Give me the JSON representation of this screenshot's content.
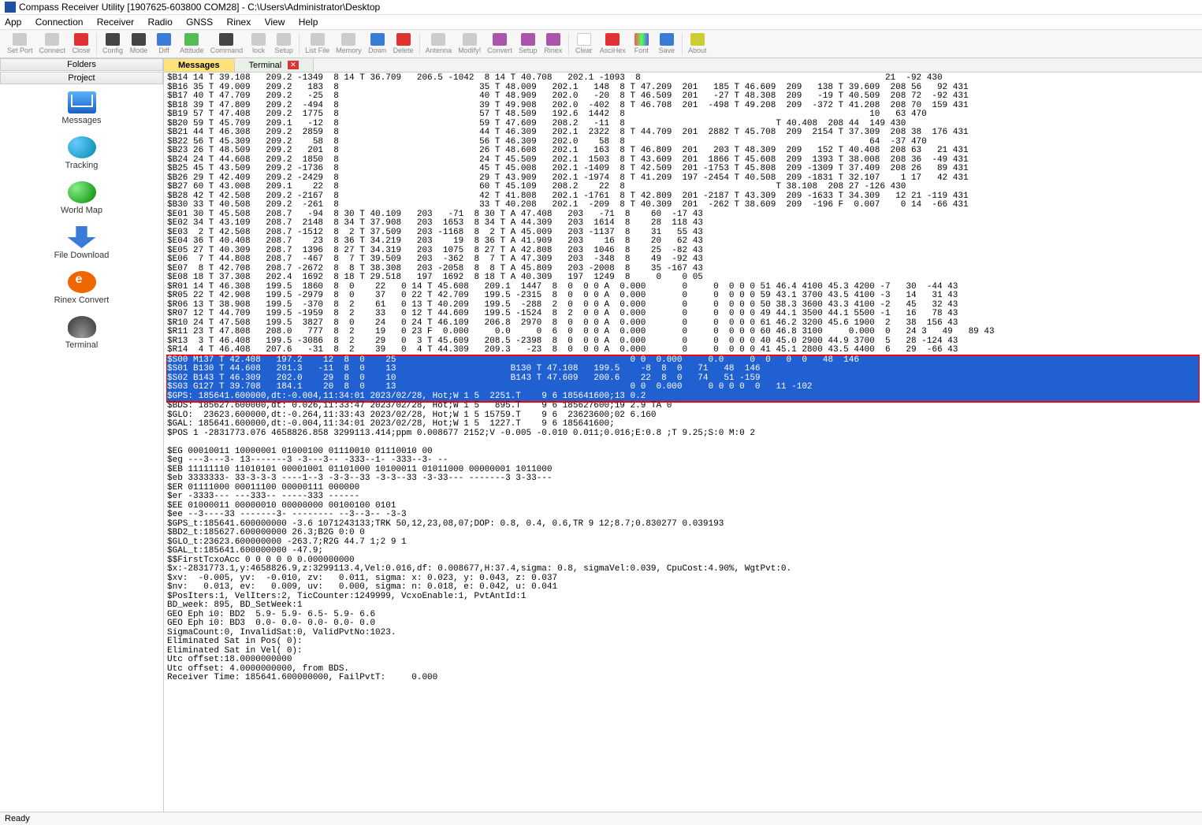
{
  "window": {
    "title": "Compass Receiver Utility [1907625-603800 COM28] - C:\\Users\\Administrator\\Desktop"
  },
  "menu": {
    "items": [
      "App",
      "Connection",
      "Receiver",
      "Radio",
      "GNSS",
      "Rinex",
      "View",
      "Help"
    ]
  },
  "toolbar": {
    "buttons": [
      "Set Port",
      "Connect",
      "Close",
      "Config",
      "Mode",
      "Diff",
      "Attitude",
      "Command",
      "lock",
      "Setup",
      "List File",
      "Memory",
      "Down",
      "Delete",
      "Antenna",
      "Modify!",
      "Convert",
      "Setup",
      "Rinex",
      "Clear",
      "AsciHex",
      "Font",
      "Save",
      "About"
    ]
  },
  "sidebar": {
    "folders": "Folders",
    "project": "Project",
    "items": [
      {
        "label": "Messages"
      },
      {
        "label": "Tracking"
      },
      {
        "label": "World Map"
      },
      {
        "label": "File Download"
      },
      {
        "label": "Rinex Convert"
      },
      {
        "label": "Terminal"
      }
    ]
  },
  "tabs": {
    "messages": "Messages",
    "terminal": "Terminal"
  },
  "terminal": {
    "pre": "$B14 14 T 39.108   209.2 -1349  8 14 T 36.709   206.5 -1042  8 14 T 40.708   202.1 -1093  8                                               21  -92 430\n$B16 35 T 49.009   209.2   183  8                           35 T 48.009   202.1   148  8 T 47.209  201   185 T 46.609  209   138 T 39.609  208 56   92 431\n$B17 40 T 47.709   209.2   -25  8                           40 T 48.909   202.0   -20  8 T 46.509  201   -27 T 48.308  209   -19 T 40.509  208 72  -92 431\n$B18 39 T 47.809   209.2  -494  8                           39 T 49.908   202.0  -402  8 T 46.708  201  -498 T 49.208  209  -372 T 41.208  208 70  159 431\n$B19 57 T 47.408   209.2  1775  8                           57 T 48.509   192.6  1442  8                                               10   63 470\n$B20 59 T 45.709   209.1   -12  8                           59 T 47.609   208.2   -11  8                             T 40.408  208 44  149 430\n$B21 44 T 46.308   209.2  2859  8                           44 T 46.309   202.1  2322  8 T 44.709  201  2882 T 45.708  209  2154 T 37.309  208 38  176 431\n$B22 56 T 45.309   209.2    58  8                           56 T 46.309   202.0    58  8                                               64  -37 470\n$B23 26 T 48.509   209.2   201  8                           26 T 48.608   202.1   163  8 T 46.809  201   203 T 48.309  209   152 T 40.408  208 63   21 431\n$B24 24 T 44.608   209.2  1850  8                           24 T 45.509   202.1  1503  8 T 43.609  201  1866 T 45.608  209  1393 T 38.008  208 36  -49 431\n$B25 45 T 43.509   209.2 -1736  8                           45 T 45.008   202.1 -1409  8 T 42.509  201 -1753 T 45.808  209 -1309 T 37.409  208 26   89 431\n$B26 29 T 42.409   209.2 -2429  8                           29 T 43.909   202.1 -1974  8 T 41.209  197 -2454 T 40.508  209 -1831 T 32.107    1 17   42 431\n$B27 60 T 43.008   209.1    22  8                           60 T 45.109   208.2    22  8                             T 38.108  208 27 -126 430\n$B28 42 T 42.508   209.2 -2167  8                           42 T 41.808   202.1 -1761  8 T 42.809  201 -2187 T 43.309  209 -1633 T 34.309   12 21 -119 431\n$B30 33 T 40.508   209.2  -261  8                           33 T 40.208   202.1  -209  8 T 40.309  201  -262 T 38.609  209  -196 F  0.007    0 14  -66 431\n$E01 30 T 45.508   208.7   -94  8 30 T 40.109   203   -71  8 30 T A 47.408   203   -71  8    60  -17 43\n$E02 34 T 43.109   208.7  2148  8 34 T 37.908   203  1653  8 34 T A 44.309   203  1614  8    28  118 43\n$E03  2 T 42.508   208.7 -1512  8  2 T 37.509   203 -1168  8  2 T A 45.009   203 -1137  8    31   55 43\n$E04 36 T 40.408   208.7    23  8 36 T 34.219   203    19  8 36 T A 41.909   203    16  8    20   62 43\n$E05 27 T 40.309   208.7  1396  8 27 T 34.319   203  1075  8 27 T A 42.808   203  1046  8    25  -82 43\n$E06  7 T 44.808   208.7  -467  8  7 T 39.509   203  -362  8  7 T A 47.309   203  -348  8    49  -92 43\n$E07  8 T 42.708   208.7 -2672  8  8 T 38.308   203 -2058  8  8 T A 45.809   203 -2008  8    35 -167 43\n$E08 18 T 37.308   202.4  1692  8 18 T 29.518   197  1692  8 18 T A 40.309   197  1249  8     0    0 05\n$R01 14 T 46.308   199.5  1860  8  0    22   0 14 T 45.608   209.1  1447  8  0  0 0 A  0.000       0     0  0 0 0 51 46.4 4100 45.3 4200 -7   30  -44 43\n$R05 22 T 42.908   199.5 -2979  8  0    37   0 22 T 42.709   199.5 -2315  8  0  0 0 A  0.000       0     0  0 0 0 59 43.1 3700 43.5 4100 -3   14   31 43\n$R06 13 T 38.908   199.5  -370  8  2    61   0 13 T 40.209   199.5  -288  2  0  0 0 A  0.000       0     0  0 0 0 50 38.3 3600 43.3 4100 -2   45   32 43\n$R07 12 T 44.709   199.5 -1959  8  2    33   0 12 T 44.609   199.5 -1524  8  2  0 0 A  0.000       0     0  0 0 0 49 44.1 3500 44.1 5500 -1   16   78 43\n$R10 24 T 47.508   199.5  3827  8  0    24   0 24 T 46.109   206.8  2970  8  0  0 0 A  0.000       0     0  0 0 0 61 46.2 3200 45.6 1900  2   38  156 43\n$R11 23 T 47.808   208.0   777  8  2    19   0 23 F  0.000     0.0     0  6  0  0 0 A  0.000       0     0  0 0 0 60 46.8 3100     0.000  0   24 3   49   89 43\n$R13  3 T 46.408   199.5 -3086  8  2    29   0  3 T 45.609   208.5 -2398  8  0  0 0 A  0.000       0     0  0 0 0 40 45.0 2900 44.9 3700  5   28 -124 43\n$R14  4 T 46.408   207.6   -31  8  2    39   0  4 T 44.309   209.3   -23  8  0  0 0 A  0.000       0     0  0 0 0 41 45.1 2800 43.5 4400  6   29  -66 43",
    "hl": "$S00 M137 T 42.408   197.2    12  8  0    25                                             0 0  0.000     0.0     0  0   0  0   48  146\n$S01 B130 T 44.608   201.3   -11  8  0    13                      B130 T 47.108   199.5    -8  8  0   71   48  146\n$S02 B143 T 46.309   202.0    29  8  0    10                      B143 T 47.609   200.6    22  8  0   74   51 -159\n$S03 G127 T 39.708   184.1    20  8  0    13                                             0 0  0.000     0 0 0 0  0   11 -102\n$GPS: 185641.600000,dt:-0.004,11:34:01 2023/02/28, Hot;W 1 5  2251.T    9 6 185641600;13 0.2",
    "post": "$BDS: 185627.600000,dt: 0.026,11:33:47 2023/02/28, Hot;W 1 5   895.T    9 6 185627600;19 2.9 TA 0\n$GLO:  23623.600000,dt:-0.264,11:33:43 2023/02/28, Hot;W 1 5 15759.T    9 6  23623600;02 6.160\n$GAL: 185641.600000,dt:-0.004,11:34:01 2023/02/28, Hot;W 1 5  1227.T    9 6 185641600;\n$POS 1 -2831773.076 4658826.858 3299113.414;ppm 0.008677 2152;V -0.005 -0.010 0.011;0.016;E:0.8 ;T 9.25;S:0 M:0 2\n\n$EG 00010011 10000001 01000100 01110010 01110010 00\n$eg ---3---3- 13-------3 -3---3-- -333--1- -333--3- --\n$EB 11111110 11010101 00001001 01101000 10100011 01011000 00000001 1011000\n$eb 3333333- 33-3-3-3 ----1--3 -3-3--33 -3-3--33 -3-33--- -------3 3-33---\n$ER 01111000 00011100 00000111 000000\n$er -3333--- ---333-- -----333 ------\n$EE 01000011 00000010 00000000 00100100 0101\n$ee --3----33 -------3- -------- --3--3-- -3-3\n$GPS_t:185641.600000000 -3.6 1071243133;TRK 50,12,23,08,07;DOP: 0.8, 0.4, 0.6,TR 9 12;8.7;0.830277 0.039193\n$BD2_t:185627.600000000 26.3;B2G 0:0 0\n$GLO_t:23623.600000000 -263.7;R2G 44.7 1;2 9 1\n$GAL_t:185641.600000000 -47.9;\n$$FirstTcxoAcc 0 0 0 0 0 0.000000000\n$x:-2831773.1,y:4658826.9,z:3299113.4,Vel:0.016,df: 0.008677,H:37.4,sigma: 0.8, sigmaVel:0.039, CpuCost:4.90%, WgtPvt:0.\n$xv:  -0.005, yv:  -0.010, zv:   0.011, sigma: x: 0.023, y: 0.043, z: 0.037\n$nv:   0.013, ev:   0.009, uv:   0.000, sigma: n: 0.018, e: 0.042, u: 0.041\n$PosIters:1, VelIters:2, TicCounter:1249999, VcxoEnable:1, PvtAntId:1\nBD_week: 895, BD_SetWeek:1\nGEO Eph i0: BD2  5.9- 5.9- 6.5- 5.9- 6.6\nGEO Eph i0: BD3  0.0- 0.0- 0.0- 0.0- 0.0\nSigmaCount:0, InvalidSat:0, ValidPvtNo:1023.\nEliminated Sat in Pos( 0):\nEliminated Sat in Vel( 0):\nUtc offset:18.0000000000\nUtc offset: 4.0000000000, from BDS.\nReceiver Time: 185641.600000000, FailPvtT:     0.000"
  },
  "status": {
    "ready": "Ready"
  }
}
